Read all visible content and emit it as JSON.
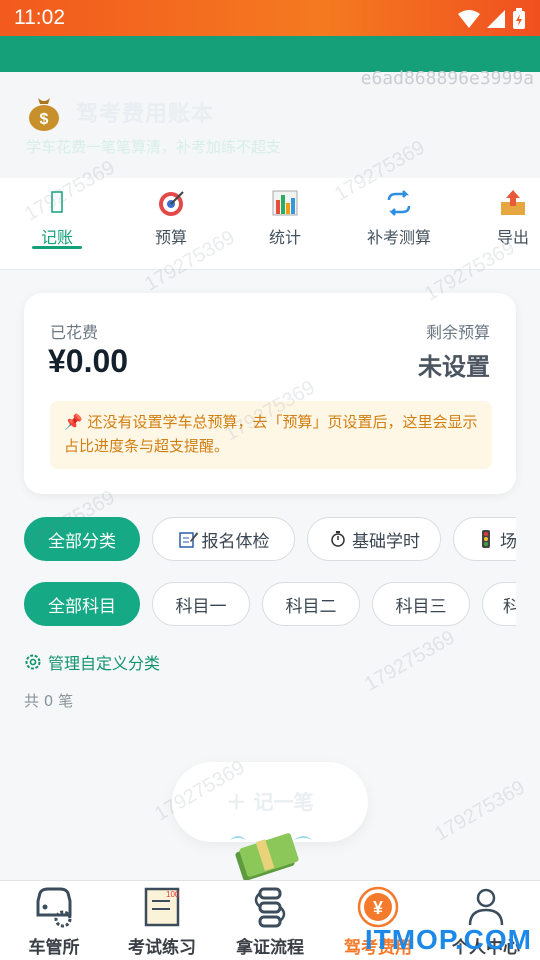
{
  "status_bar": {
    "time": "11:02"
  },
  "header": {
    "title": "驾考费用账本",
    "subtitle": "学车花费一笔笔算清，补考加练不超支",
    "watermark_id": "e6ad868896e3999a"
  },
  "tabs": [
    {
      "label": "记账",
      "icon": "notebook-icon",
      "active": true
    },
    {
      "label": "预算",
      "icon": "target-icon"
    },
    {
      "label": "统计",
      "icon": "bar-chart-icon"
    },
    {
      "label": "补考测算",
      "icon": "refresh-icon"
    },
    {
      "label": "导出",
      "icon": "export-icon"
    }
  ],
  "summary": {
    "spent_label": "已花费",
    "spent_value": "¥0.00",
    "remain_label": "剩余预算",
    "remain_value": "未设置",
    "notice": "📌 还没有设置学车总预算，去「预算」页设置后，这里会显示占比进度条与超支提醒。"
  },
  "category_chips": [
    {
      "label": "全部分类",
      "active": true
    },
    {
      "label": "报名体检",
      "icon": "pen-paper-icon"
    },
    {
      "label": "基础学时",
      "icon": "timer-icon"
    },
    {
      "label": "场",
      "icon": "traffic-light-icon"
    }
  ],
  "subject_chips": [
    {
      "label": "全部科目",
      "active": true
    },
    {
      "label": "科目一"
    },
    {
      "label": "科目二"
    },
    {
      "label": "科目三"
    },
    {
      "label": "科"
    }
  ],
  "manage_label": "管理自定义分类",
  "count_label": "共 0 笔",
  "fab_label": "＋ 记一笔",
  "watermark_text": "179275369",
  "bottom_nav": [
    {
      "label": "车管所",
      "icon": "car-gear-icon"
    },
    {
      "label": "考试练习",
      "icon": "exam-paper-icon"
    },
    {
      "label": "拿证流程",
      "icon": "flow-icon"
    },
    {
      "label": "驾考费用",
      "icon": "yuan-coin-icon",
      "active": true
    },
    {
      "label": "个人中心",
      "icon": "person-icon"
    }
  ],
  "site_logo": "ITMOP.COM",
  "colors": {
    "primary": "#15a985",
    "accent": "#f57a2b",
    "status_bar": "#f25a1e"
  }
}
